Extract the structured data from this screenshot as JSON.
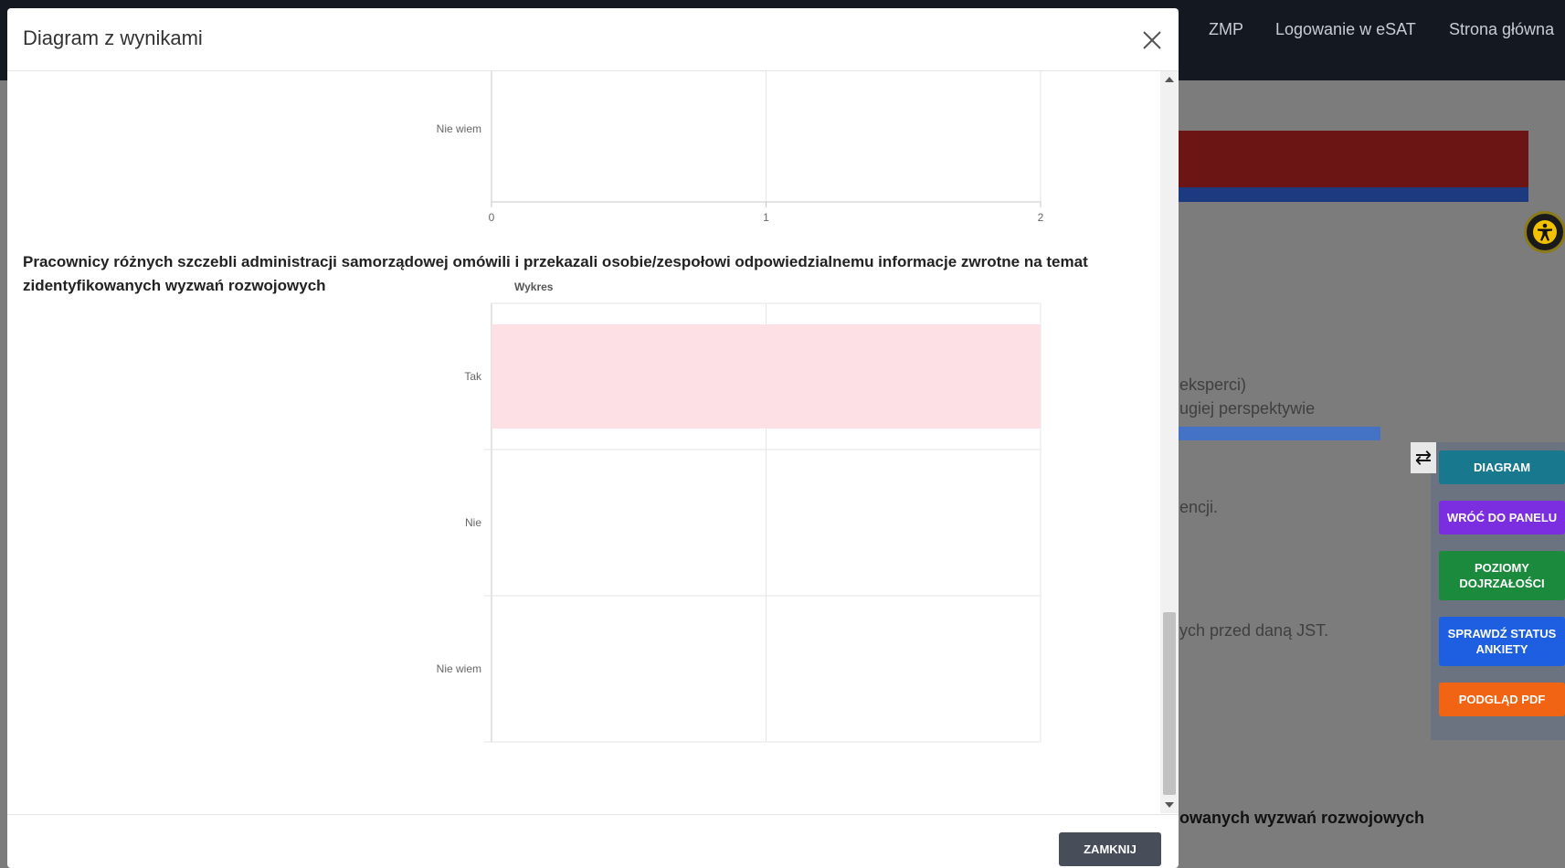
{
  "background": {
    "nav": {
      "links": [
        "ZMP",
        "Logowanie w eSAT",
        "Strona główna"
      ]
    },
    "text_fragments": [
      "eksperci)",
      "ugiej perspektywie",
      "encji.",
      "ych przed daną JST."
    ],
    "bold_fragment": "owanych wyzwań rozwojowych",
    "side_buttons": [
      {
        "label": "DIAGRAM",
        "color": "#17788e"
      },
      {
        "label": "WRÓĆ DO PANELU",
        "color": "#7b2ee0"
      },
      {
        "label": "POZIOMY DOJRZAŁOŚCI",
        "color": "#1b8a3c"
      },
      {
        "label": "SPRAWDŹ STATUS ANKIETY",
        "color": "#1d5fe0"
      },
      {
        "label": "PODGLĄD PDF",
        "color": "#f06414"
      }
    ],
    "swap_icon": "swap-arrows-icon",
    "accessibility_icon": "accessibility-icon"
  },
  "modal": {
    "title": "Diagram z wynikami",
    "close_icon": "close-icon",
    "footer_button": "ZAMKNIJ"
  },
  "question": {
    "text": "Pracownicy różnych szczebli administracji samorządowej omówili i przekazali osobie/zespołowi odpowiedzialnemu informacje zwrotne na temat zidentyfikowanych wyzwań rozwojowych"
  },
  "chart_data": [
    {
      "type": "bar",
      "orientation": "horizontal",
      "partial": true,
      "categories": [
        "Nie wiem"
      ],
      "x_ticks": [
        "0",
        "1",
        "2"
      ],
      "xlim": [
        0,
        2
      ],
      "series": [
        {
          "values": [
            0
          ]
        }
      ]
    },
    {
      "type": "bar",
      "orientation": "horizontal",
      "title": "Wykres",
      "categories": [
        "Tak",
        "Nie",
        "Nie wiem"
      ],
      "xlim": [
        0,
        2
      ],
      "series": [
        {
          "values": [
            2,
            0,
            0
          ],
          "color": "#fde0e6"
        }
      ]
    }
  ]
}
